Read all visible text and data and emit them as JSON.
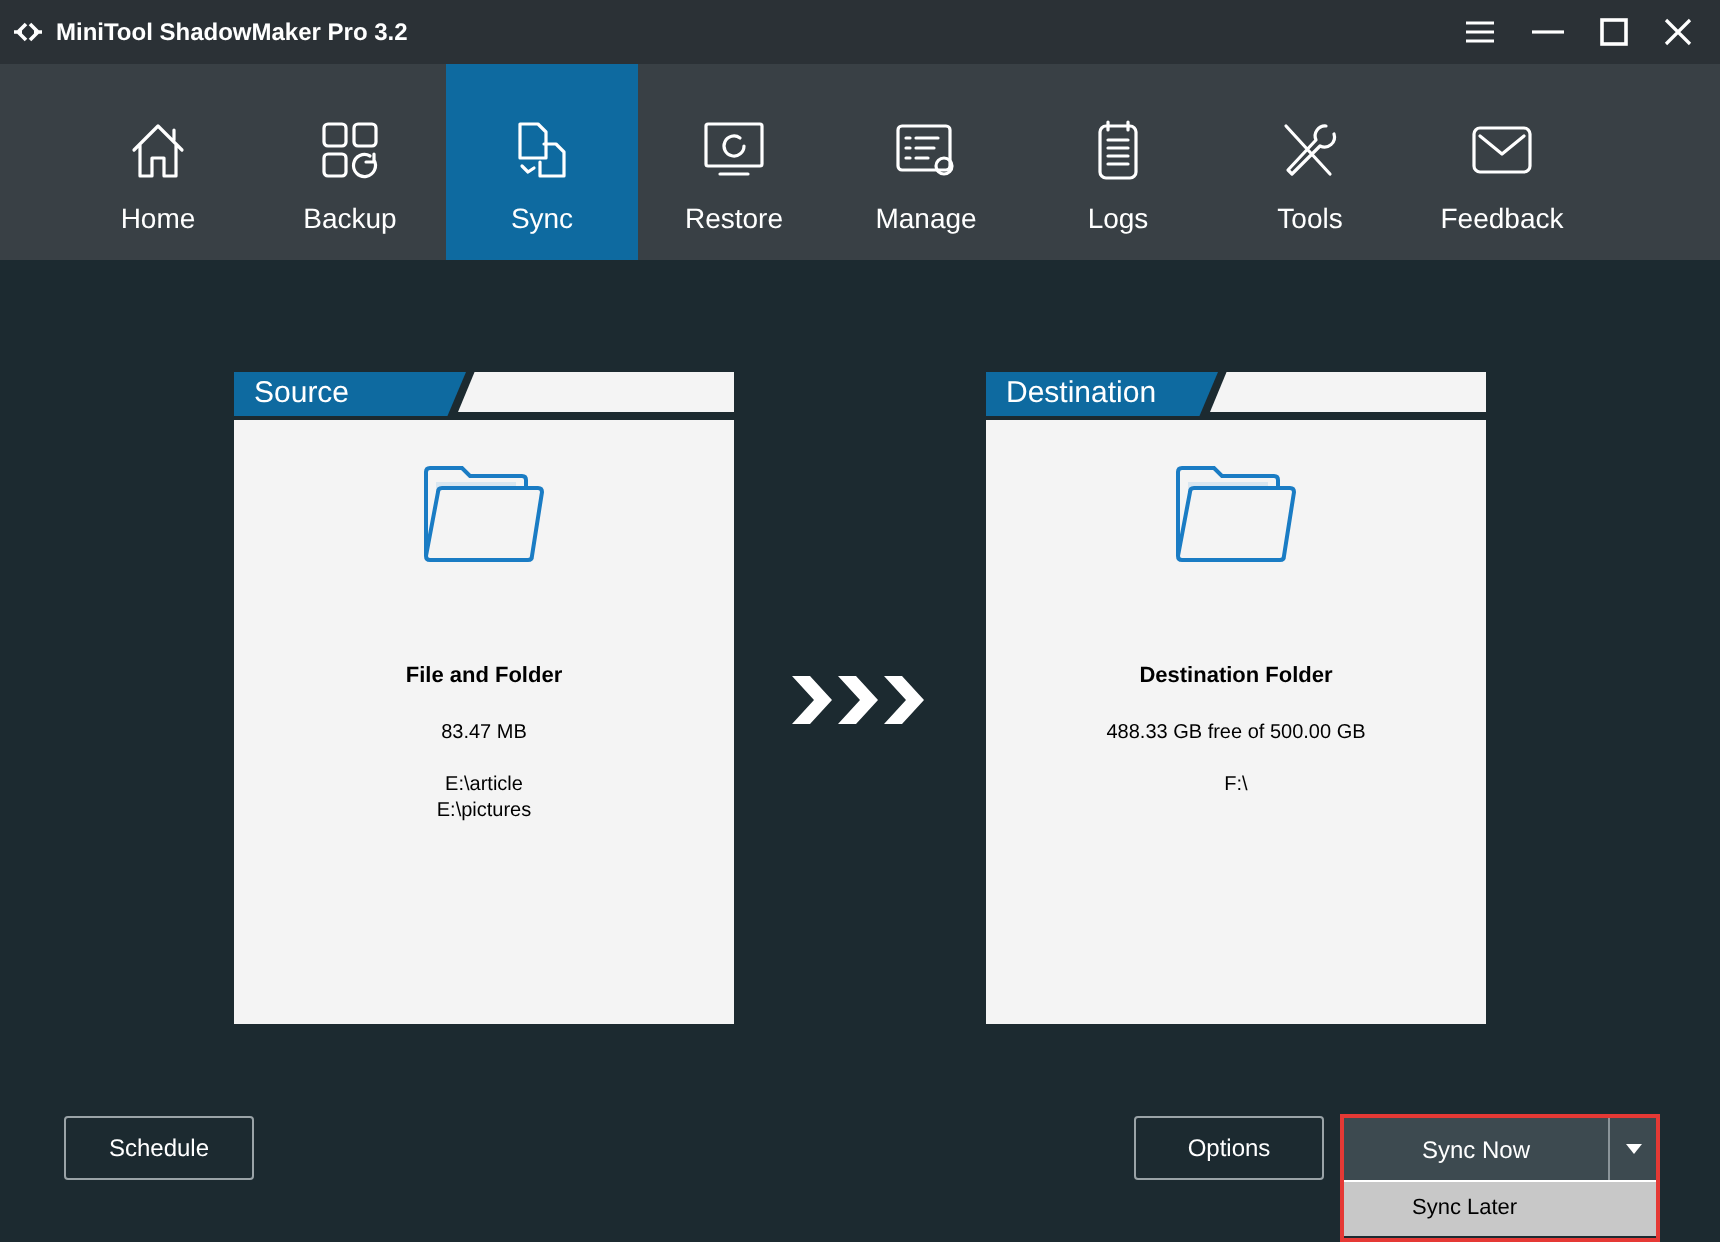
{
  "window": {
    "title": "MiniTool ShadowMaker Pro 3.2"
  },
  "tabs": [
    {
      "label": "Home",
      "selected": false
    },
    {
      "label": "Backup",
      "selected": false
    },
    {
      "label": "Sync",
      "selected": true
    },
    {
      "label": "Restore",
      "selected": false
    },
    {
      "label": "Manage",
      "selected": false
    },
    {
      "label": "Logs",
      "selected": false
    },
    {
      "label": "Tools",
      "selected": false
    },
    {
      "label": "Feedback",
      "selected": false
    }
  ],
  "panels": [
    {
      "header": "Source",
      "title": "File and Folder",
      "size": "83.47 MB",
      "paths": [
        "E:\\article",
        "E:\\pictures"
      ]
    },
    {
      "header": "Destination",
      "title": "Destination Folder",
      "size": "488.33 GB free of 500.00 GB",
      "paths": [
        "F:\\"
      ]
    }
  ],
  "buttons": {
    "schedule": "Schedule",
    "options": "Options",
    "sync_now": "Sync Now",
    "menu": [
      {
        "label": "Sync Later"
      }
    ]
  }
}
